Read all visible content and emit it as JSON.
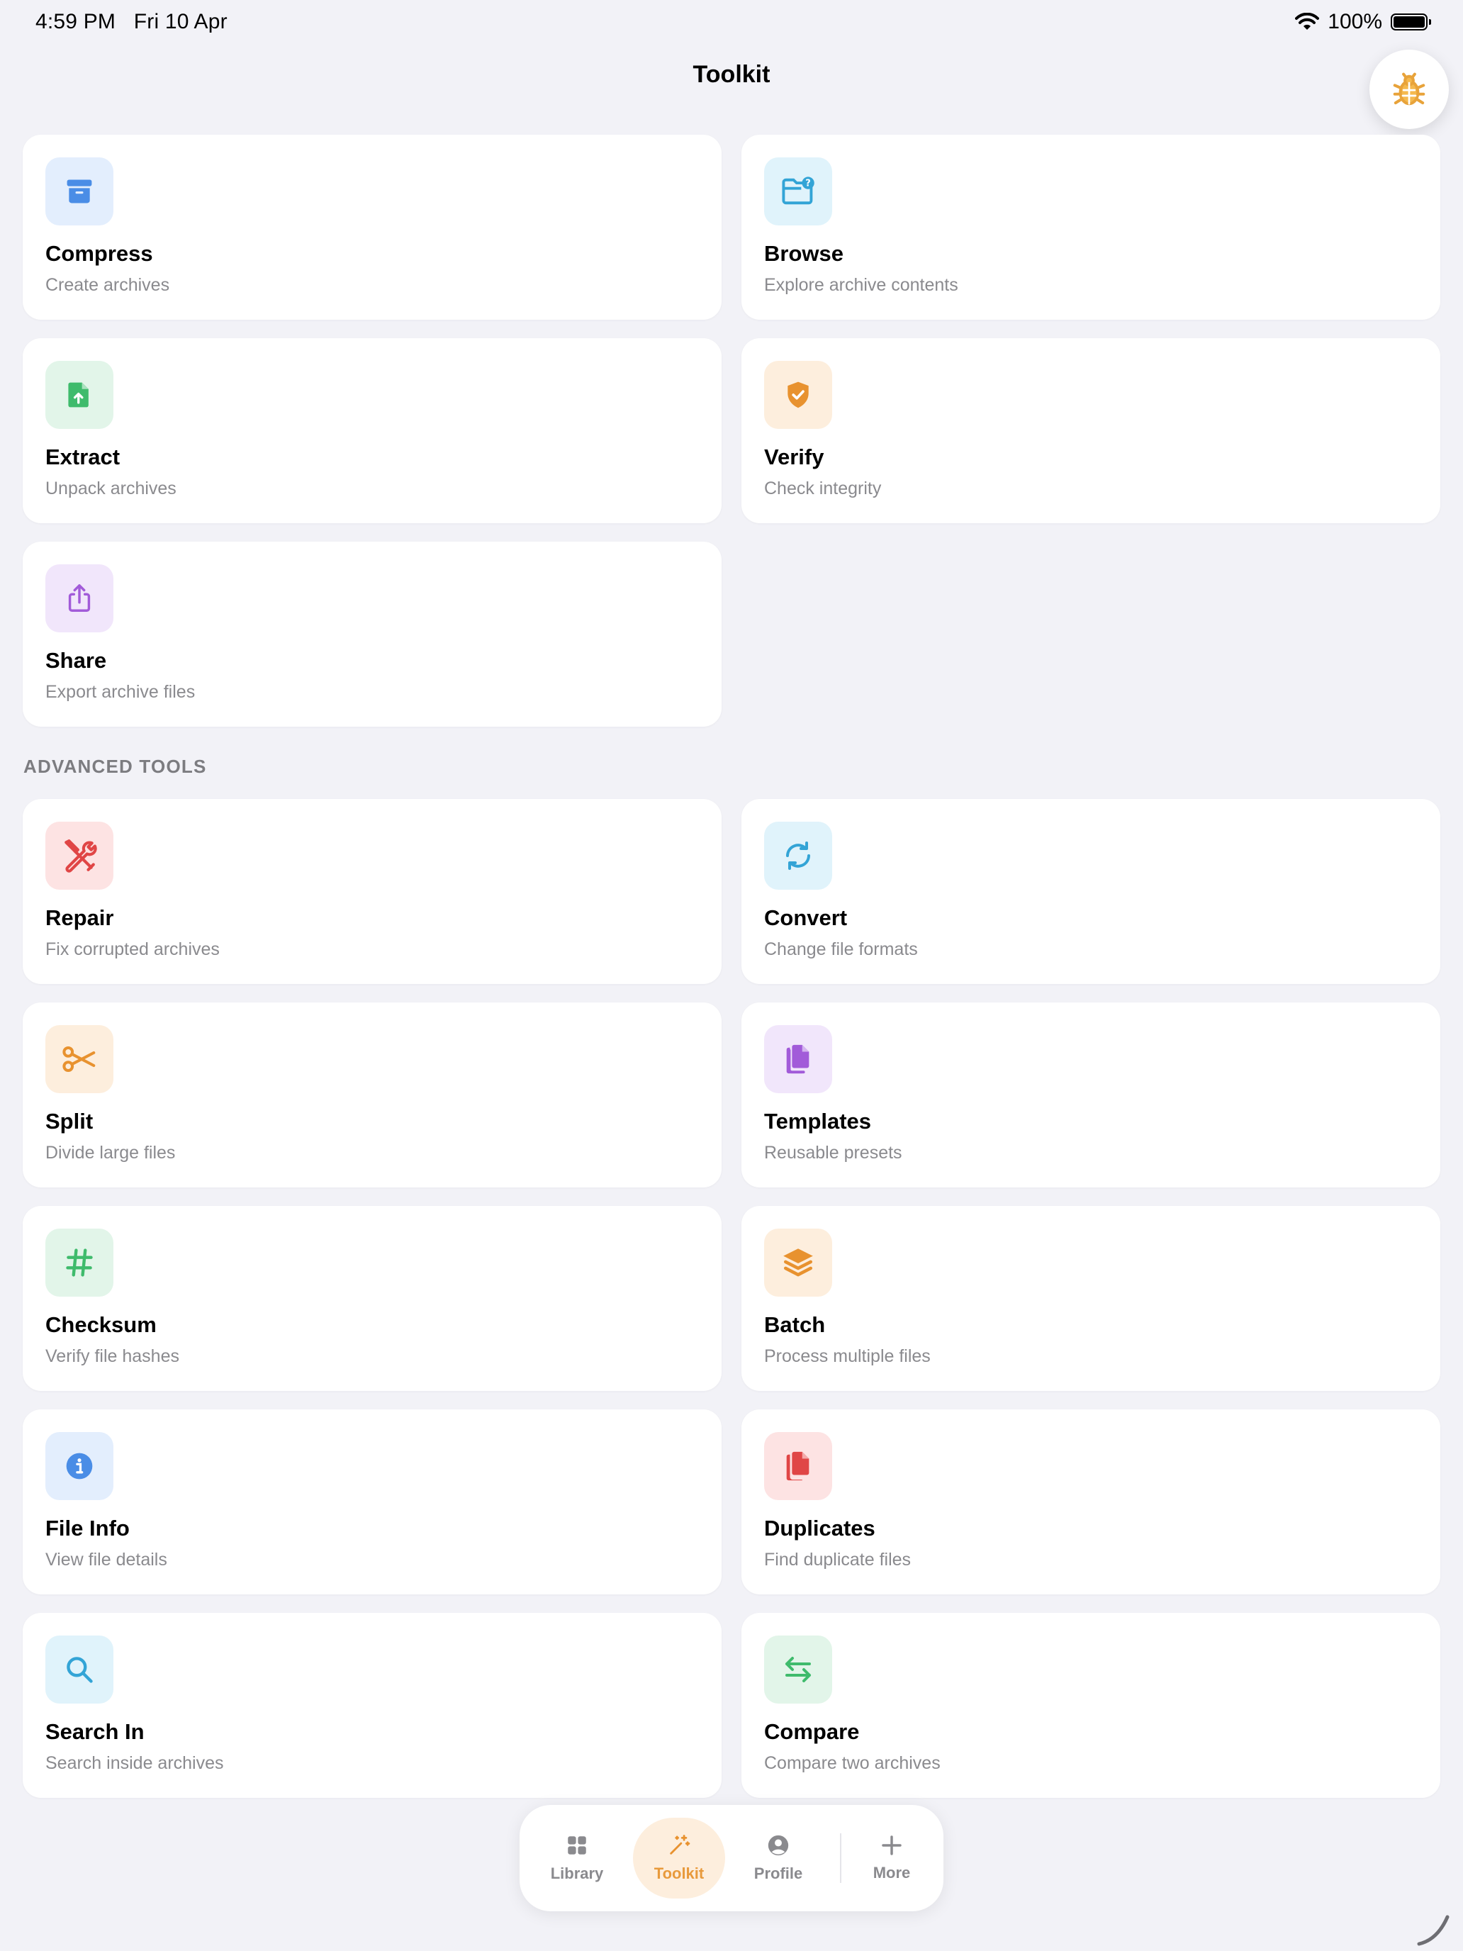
{
  "status": {
    "time": "4:59 PM",
    "date": "Fri 10 Apr",
    "battery": "100%"
  },
  "nav": {
    "title": "Toolkit"
  },
  "tools": [
    {
      "title": "Compress",
      "subtitle": "Create archives",
      "icon": "archive-box-icon",
      "bg": "#e3eefd",
      "fg": "#4a8de6"
    },
    {
      "title": "Browse",
      "subtitle": "Explore archive contents",
      "icon": "folder-question-icon",
      "bg": "#e0f3fb",
      "fg": "#33a4d6"
    },
    {
      "title": "Extract",
      "subtitle": "Unpack archives",
      "icon": "file-upload-icon",
      "bg": "#e2f5e9",
      "fg": "#3fbb6c"
    },
    {
      "title": "Verify",
      "subtitle": "Check integrity",
      "icon": "shield-check-icon",
      "bg": "#fdeedd",
      "fg": "#e8922f"
    },
    {
      "title": "Share",
      "subtitle": "Export archive files",
      "icon": "share-icon",
      "bg": "#f1e6fb",
      "fg": "#a25bd9"
    }
  ],
  "advanced": {
    "header": "ADVANCED TOOLS",
    "items": [
      {
        "title": "Repair",
        "subtitle": "Fix corrupted archives",
        "icon": "wrench-screwdriver-icon",
        "bg": "#fde3e3",
        "fg": "#e04646"
      },
      {
        "title": "Convert",
        "subtitle": "Change file formats",
        "icon": "sync-arrows-icon",
        "bg": "#e0f3fb",
        "fg": "#33a4d6"
      },
      {
        "title": "Split",
        "subtitle": "Divide large files",
        "icon": "scissors-icon",
        "bg": "#fdeedd",
        "fg": "#e8922f"
      },
      {
        "title": "Templates",
        "subtitle": "Reusable presets",
        "icon": "documents-icon",
        "bg": "#f1e6fb",
        "fg": "#a25bd9"
      },
      {
        "title": "Checksum",
        "subtitle": "Verify file hashes",
        "icon": "hash-icon",
        "bg": "#e2f5e9",
        "fg": "#3fbb6c"
      },
      {
        "title": "Batch",
        "subtitle": "Process multiple files",
        "icon": "layers-icon",
        "bg": "#fdeedd",
        "fg": "#e8922f"
      },
      {
        "title": "File Info",
        "subtitle": "View file details",
        "icon": "info-circle-icon",
        "bg": "#e3eefd",
        "fg": "#4a8de6"
      },
      {
        "title": "Duplicates",
        "subtitle": "Find duplicate files",
        "icon": "copy-files-icon",
        "bg": "#fde3e3",
        "fg": "#e04646"
      },
      {
        "title": "Search In",
        "subtitle": "Search inside archives",
        "icon": "search-icon",
        "bg": "#e0f3fb",
        "fg": "#33a4d6"
      },
      {
        "title": "Compare",
        "subtitle": "Compare two archives",
        "icon": "compare-arrows-icon",
        "bg": "#e2f5e9",
        "fg": "#3fbb6c"
      }
    ]
  },
  "tabbar": {
    "items": [
      {
        "label": "Library",
        "icon": "grid-icon",
        "active": false
      },
      {
        "label": "Toolkit",
        "icon": "magic-wand-icon",
        "active": true
      },
      {
        "label": "Profile",
        "icon": "person-circle-icon",
        "active": false
      },
      {
        "label": "More",
        "icon": "plus-icon",
        "active": false
      }
    ]
  },
  "colors": {
    "accent": "#e8922f",
    "background": "#f2f2f7"
  }
}
